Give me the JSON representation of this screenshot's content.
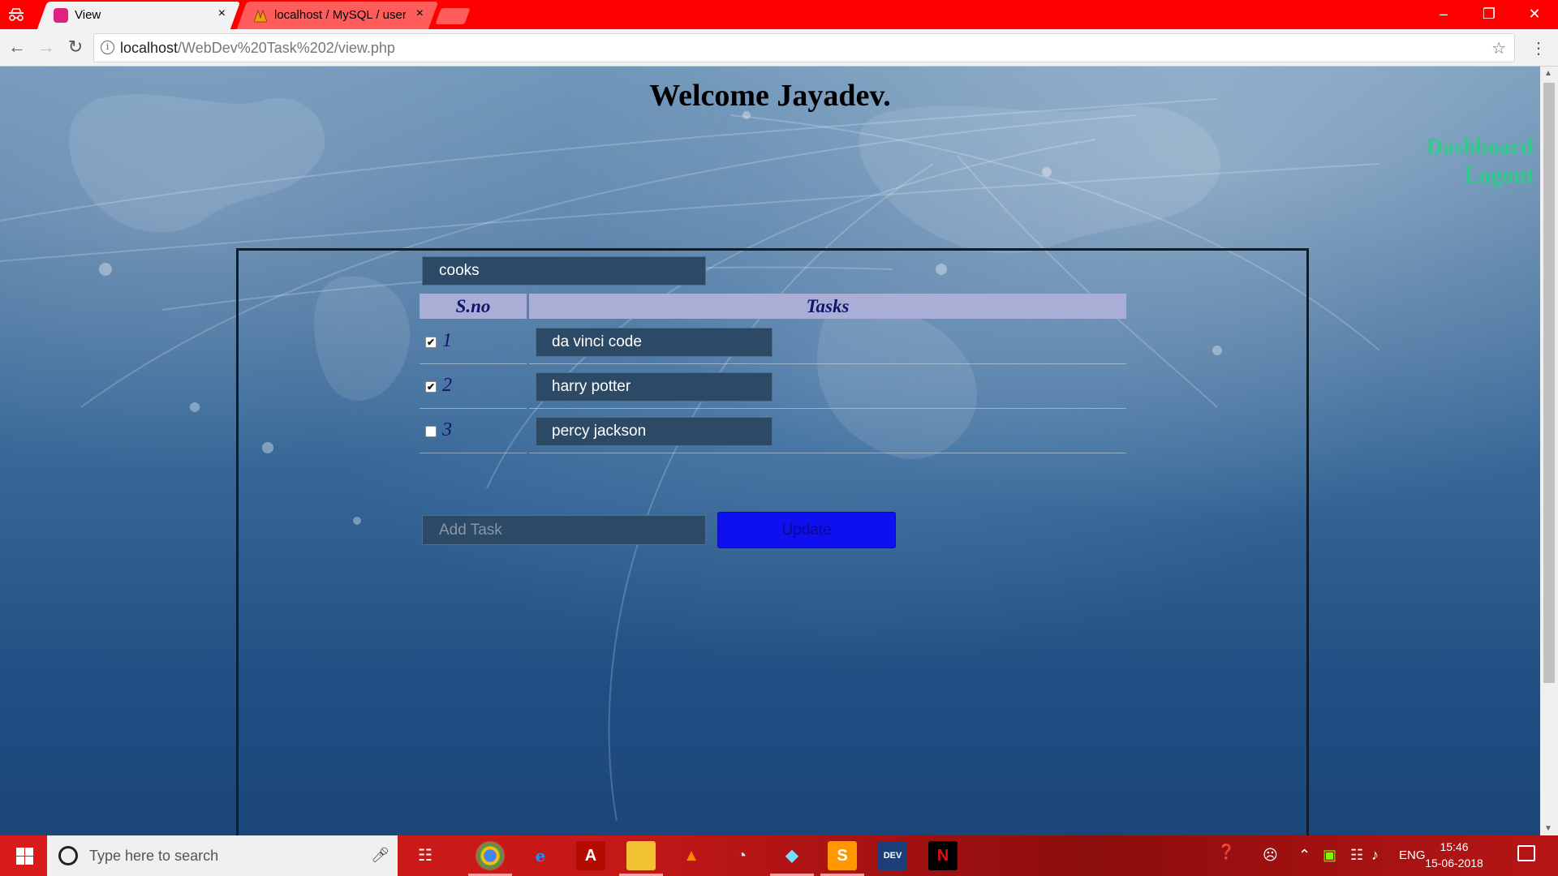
{
  "browser": {
    "tabs": [
      {
        "title": "View",
        "close": "×"
      },
      {
        "title": "localhost / MySQL / users",
        "close": "×"
      }
    ],
    "url_host": "localhost",
    "url_path": "/WebDev%20Task%202/view.php"
  },
  "page": {
    "welcome": "Welcome Jayadev.",
    "nav": {
      "dashboard": "Dashboard",
      "logout": "Logout"
    },
    "list_title": "cooks",
    "table": {
      "headers": [
        "S.no",
        "Tasks"
      ],
      "rows": [
        {
          "sno": "1",
          "task": "da vinci code",
          "checked": true
        },
        {
          "sno": "2",
          "task": "harry potter",
          "checked": true
        },
        {
          "sno": "3",
          "task": "percy jackson",
          "checked": false
        }
      ]
    },
    "add_task_placeholder": "Add Task",
    "update_label": "Update"
  },
  "taskbar": {
    "search_placeholder": "Type here to search",
    "lang": "ENG",
    "time": "15:46",
    "date": "15-06-2018"
  },
  "colors": {
    "tabbar": "#fe0000",
    "link": "#2ecc8a",
    "header_bg": "#a9aed6",
    "header_text": "#14136e",
    "update_button": "#0f10f0"
  }
}
